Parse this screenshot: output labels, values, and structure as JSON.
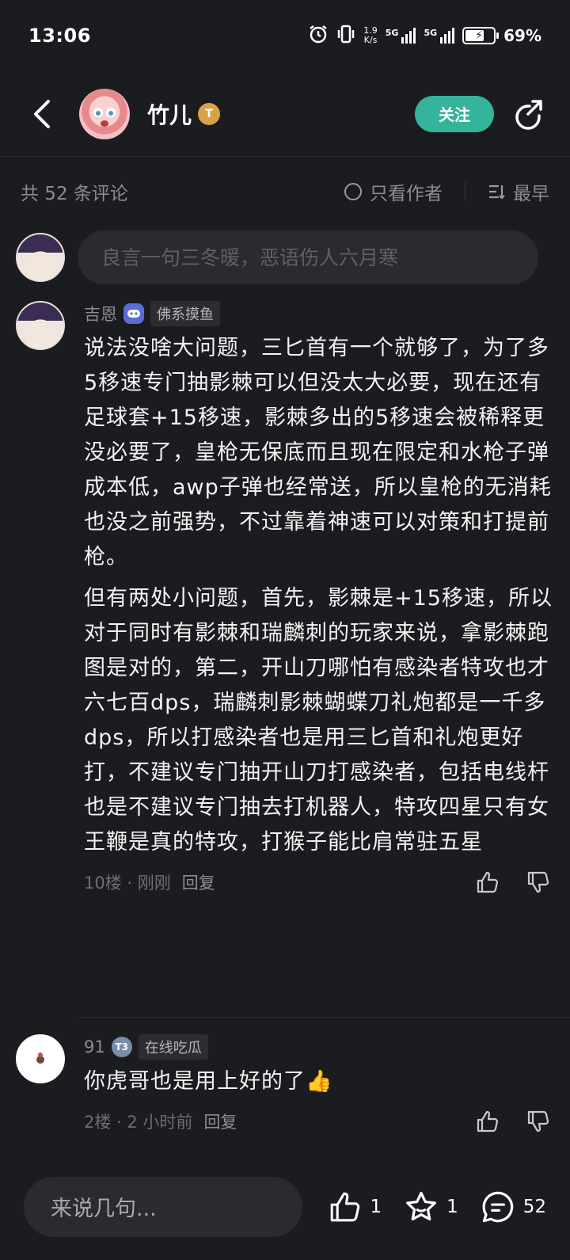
{
  "status_bar": {
    "time": "13:06",
    "net_speed": "1.9\nK/s",
    "sim1_tag": "5G",
    "sim2_tag": "5G",
    "battery": "69%"
  },
  "header": {
    "user_name": "竹儿",
    "level_badge": "T",
    "follow_label": "关注"
  },
  "filter_bar": {
    "count_label": "共 52 条评论",
    "author_only_label": "只看作者",
    "sort_label": "最早"
  },
  "composer": {
    "placeholder": "良言一句三冬暖，恶语伤人六月寒"
  },
  "comments": [
    {
      "user": "吉恩",
      "tag": "佛系摸鱼",
      "paragraphs": [
        "说法没啥大问题，三匕首有一个就够了，为了多5移速专门抽影棘可以但没太大必要，现在还有足球套+15移速，影棘多出的5移速会被稀释更没必要了，皇枪无保底而且现在限定和水枪子弹成本低，awp子弹也经常送，所以皇枪的无消耗也没之前强势，不过靠着神速可以对策和打提前枪。",
        "但有两处小问题，首先，影棘是+15移速，所以对于同时有影棘和瑞麟刺的玩家来说，拿影棘跑图是对的，第二，开山刀哪怕有感染者特攻也才六七百dps，瑞麟刺影棘蝴蝶刀礼炮都是一千多dps，所以打感染者也是用三匕首和礼炮更好打，不建议专门抽开山刀打感染者，包括电线杆也是不建议专门抽去打机器人，特攻四星只有女王鞭是真的特攻，打猴子能比肩常驻五星"
      ],
      "meta": "10楼 · 刚刚",
      "reply_label": "回复"
    },
    {
      "user": "91",
      "level": "T3",
      "tag": "在线吃瓜",
      "text": "你虎哥也是用上好的了👍",
      "meta": "2楼 · 2 小时前",
      "reply_label": "回复"
    }
  ],
  "bottom_bar": {
    "input_placeholder": "来说几句...",
    "like_count": "1",
    "favorite_count": "1",
    "comment_count": "52"
  }
}
